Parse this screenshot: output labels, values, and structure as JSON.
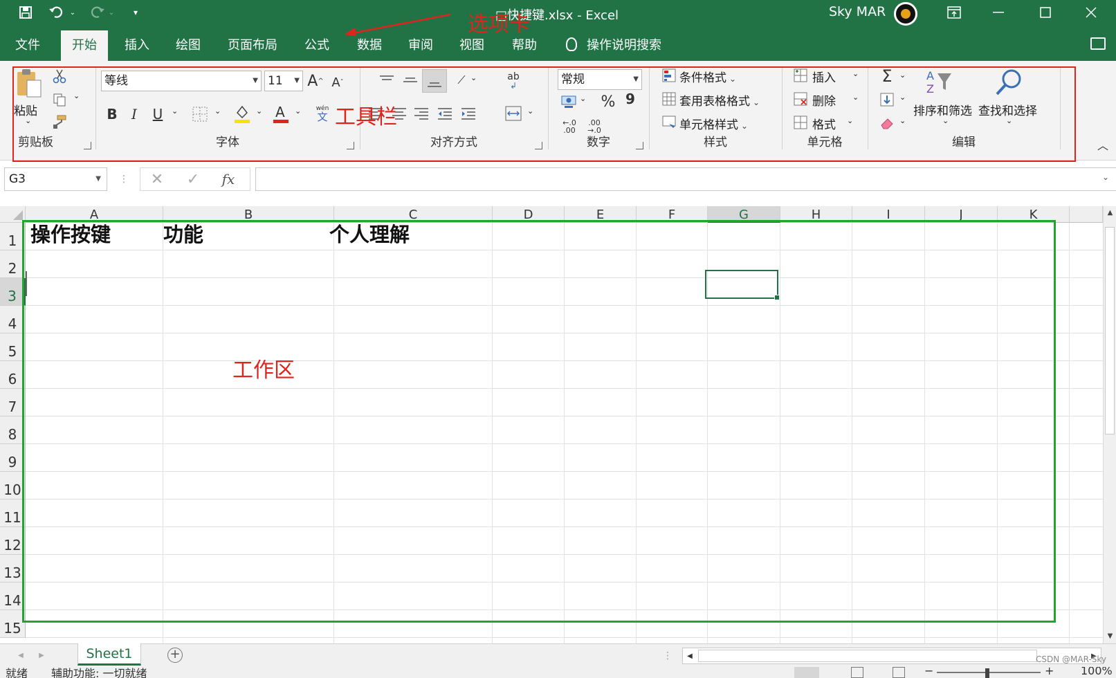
{
  "titlebar": {
    "title": "□快捷键.xlsx  -  Excel",
    "user": "Sky MAR"
  },
  "tabs": [
    {
      "label": "文件"
    },
    {
      "label": "开始"
    },
    {
      "label": "插入"
    },
    {
      "label": "绘图"
    },
    {
      "label": "页面布局"
    },
    {
      "label": "公式"
    },
    {
      "label": "数据"
    },
    {
      "label": "审阅"
    },
    {
      "label": "视图"
    },
    {
      "label": "帮助"
    }
  ],
  "tell_me": "操作说明搜索",
  "ribbon": {
    "clipboard": {
      "paste": "粘贴",
      "group": "剪贴板"
    },
    "font": {
      "name": "等线",
      "size": "11",
      "group": "字体",
      "bold": "B",
      "italic": "I",
      "underline": "U",
      "wen": "wén",
      "wen2": "文"
    },
    "alignment": {
      "group": "对齐方式"
    },
    "number": {
      "format": "常规",
      "percent": "%",
      "comma": "9",
      "group": "数字"
    },
    "styles": {
      "conditional": "条件格式",
      "table": "套用表格格式",
      "cell": "单元格样式",
      "group": "样式"
    },
    "cells": {
      "insert": "插入",
      "delete": "删除",
      "format": "格式",
      "group": "单元格"
    },
    "editing": {
      "sort": "排序和筛选",
      "find": "查找和选择",
      "group": "编辑"
    }
  },
  "annotations": {
    "tabs_label": "选项卡",
    "toolbar_label": "工具栏",
    "workarea_label": "工作区"
  },
  "formula_bar": {
    "name_box": "G3",
    "fx": "fx",
    "value": ""
  },
  "columns": [
    "A",
    "B",
    "C",
    "D",
    "E",
    "F",
    "G",
    "H",
    "I",
    "J",
    "K"
  ],
  "rows": [
    "1",
    "2",
    "3",
    "4",
    "5",
    "6",
    "7",
    "8",
    "9",
    "10",
    "11",
    "12",
    "13",
    "14",
    "15"
  ],
  "cells": {
    "A1": "操作按键",
    "B1": "功能",
    "C1": "个人理解"
  },
  "selected_cell": "G3",
  "sheet_tab": "Sheet1",
  "status": {
    "ready": "就绪",
    "accessibility": "辅助功能: 一切就绪",
    "zoom": "100%"
  },
  "watermark": "CSDN @MAR-Sky",
  "colors": {
    "excel_green": "#217346",
    "annotation_red": "#e0231c",
    "annotation_green": "#22a52c"
  }
}
